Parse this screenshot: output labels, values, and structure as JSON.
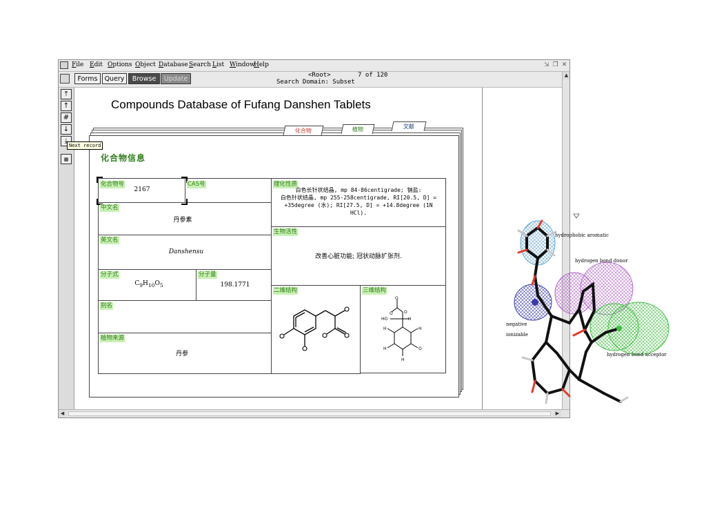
{
  "menubar": {
    "items": [
      {
        "key": "F",
        "rest": "ile"
      },
      {
        "key": "E",
        "rest": "dit"
      },
      {
        "key": "O",
        "rest": "ptions"
      },
      {
        "key": "O",
        "rest": "bject"
      },
      {
        "key": "D",
        "rest": "atabase"
      },
      {
        "key": "S",
        "rest": "earch"
      },
      {
        "key": "L",
        "rest": "ist"
      },
      {
        "key": "W",
        "rest": "indow"
      },
      {
        "key": "H",
        "rest": "elp"
      }
    ]
  },
  "toolbar": {
    "forms": "Forms",
    "query": "Query",
    "browse": "Browse",
    "update": "Update",
    "root": "<Root>",
    "record": "7  of 120",
    "search_domain": "Search Domain: Subset"
  },
  "nav": {
    "first": "⤒",
    "prev": "↑",
    "goto": "#",
    "next": "↓",
    "last": "⤓",
    "tooltip": "Next record"
  },
  "title": "Compounds Database of Fufang Danshen Tablets",
  "tabs": [
    "化合物",
    "植物",
    "文献"
  ],
  "section_title": "化合物信息",
  "fields": {
    "compound_no_label": "化合物号",
    "compound_no": "2167",
    "cas_label": "CAS号",
    "cn_name_label": "中文名",
    "cn_name": "丹参素",
    "en_name_label": "英文名",
    "en_name": "Danshensu",
    "formula_label": "分子式",
    "formula_c": "C",
    "formula_c_sub": "9",
    "formula_h": "H",
    "formula_h_sub": "10",
    "formula_o": "O",
    "formula_o_sub": "5",
    "mw_label": "分子量",
    "mw": "198.1771",
    "alias_label": "别名",
    "source_label": "植物来源",
    "source": "丹参",
    "phys_label": "理化性质",
    "phys_line1": "白色长针状结晶, mp 84-86centigrade; 钠盐:",
    "phys_line2": "白色针状结晶, mp 255-258centigrade, RI[20.5, D] =",
    "phys_line3": "+35degree (水); RI[27.5, D] = +14.8degree (1N",
    "phys_line4": "HCl).",
    "bio_label": "生物活性",
    "bio": "改善心脏功能; 冠状动脉扩张剂.",
    "s2d_label": "二维结构",
    "s3d_label": "三维结构"
  },
  "pharmacophore": {
    "hydrophobic": "hydrophobic aromatic",
    "donor": "hydrogen bond donor",
    "negative1": "negative",
    "negative2": "ionizable",
    "acceptor": "hydrogen bond acceptor"
  },
  "colors": {
    "label_bg": "#c8f0b4",
    "label_fg": "#2f7d16",
    "hydrophobic": "#5fa3d0",
    "donor": "#b267c9",
    "acceptor": "#3fbf3f",
    "negative": "#3a3ab0"
  }
}
